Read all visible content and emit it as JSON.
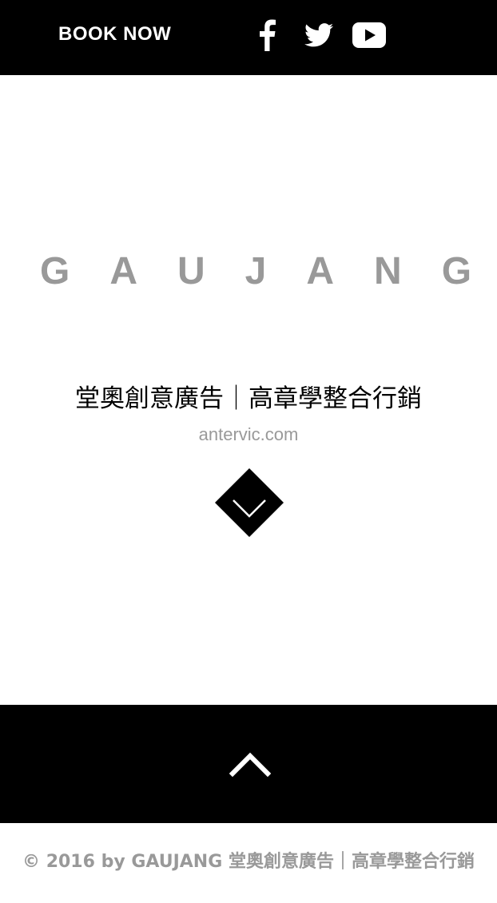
{
  "header": {
    "book_now_label": "BOOK NOW",
    "social": [
      {
        "icon": "facebook-icon"
      },
      {
        "icon": "twitter-icon"
      },
      {
        "icon": "youtube-icon"
      }
    ]
  },
  "hero": {
    "brand": "GAUJANG",
    "tagline": "堂奧創意廣告｜高章學整合行銷",
    "site": "antervic.com",
    "scroll_icon": "chevron-down-diamond-icon"
  },
  "back_to_top": {
    "icon": "chevron-up-icon"
  },
  "footer": {
    "copyright": "© 2016 by GAUJANG 堂奧創意廣告｜高章學整合行銷"
  },
  "colors": {
    "bar": "#000000",
    "text_gray": "#999999",
    "text_dark": "#000000",
    "background": "#ffffff"
  }
}
